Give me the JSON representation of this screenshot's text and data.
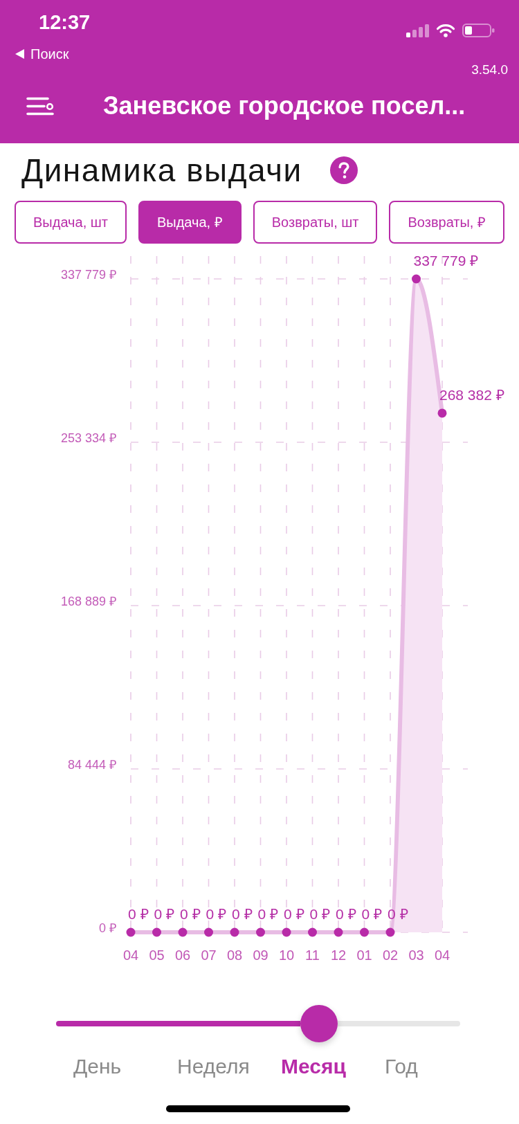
{
  "status_bar": {
    "time": "12:37",
    "back_label": "Поиск"
  },
  "app_version": "3.54.0",
  "header": {
    "title": "Заневское городское посел..."
  },
  "section": {
    "title": "Динамика выдачи"
  },
  "metric_tabs": [
    {
      "label": "Выдача, шт",
      "selected": false
    },
    {
      "label": "Выдача, ₽",
      "selected": true
    },
    {
      "label": "Возвраты, шт",
      "selected": false
    },
    {
      "label": "Возвраты, ₽",
      "selected": false
    }
  ],
  "chart": {
    "chart_data": {
      "type": "area",
      "grid": true,
      "categories": [
        "04",
        "05",
        "06",
        "07",
        "08",
        "09",
        "10",
        "11",
        "12",
        "01",
        "02",
        "03",
        "04"
      ],
      "values": [
        0,
        0,
        0,
        0,
        0,
        0,
        0,
        0,
        0,
        0,
        0,
        337779,
        268382
      ],
      "ylim": [
        0,
        337779
      ],
      "yticks": [
        {
          "value": 0,
          "label": "0 ₽"
        },
        {
          "value": 84444,
          "label": "84 444 ₽"
        },
        {
          "value": 168889,
          "label": "168 889 ₽"
        },
        {
          "value": 253334,
          "label": "253 334 ₽"
        },
        {
          "value": 337779,
          "label": "337 779 ₽"
        }
      ],
      "value_labels": [
        "0 ₽",
        "0 ₽",
        "0 ₽",
        "0 ₽",
        "0 ₽",
        "0 ₽",
        "0 ₽",
        "0 ₽",
        "0 ₽",
        "0 ₽",
        "0 ₽",
        "337 779 ₽",
        "268 382 ₽"
      ]
    }
  },
  "period_slider": {
    "level": 0.65
  },
  "periods": [
    {
      "label": "День",
      "selected": false
    },
    {
      "label": "Неделя",
      "selected": false
    },
    {
      "label": "Месяц",
      "selected": true
    },
    {
      "label": "Год",
      "selected": false
    }
  ]
}
